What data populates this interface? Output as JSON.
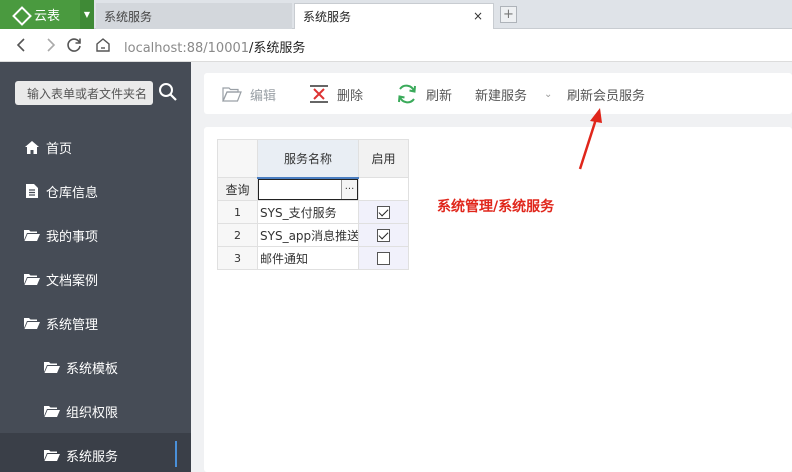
{
  "browser": {
    "brand": "云表",
    "tabs": [
      {
        "label": "系统服务",
        "active": false
      },
      {
        "label": "系统服务",
        "active": true
      }
    ],
    "close_glyph": "×",
    "url": {
      "host": "localhost:88/10001",
      "path": "/系统服务"
    }
  },
  "sidebar": {
    "search_placeholder": "输入表单或者文件夹名",
    "items": [
      {
        "label": "首页",
        "icon": "home-icon",
        "level": 0
      },
      {
        "label": "仓库信息",
        "icon": "document-icon",
        "level": 0
      },
      {
        "label": "我的事项",
        "icon": "folder-open-icon",
        "level": 0
      },
      {
        "label": "文档案例",
        "icon": "folder-open-icon",
        "level": 0
      },
      {
        "label": "系统管理",
        "icon": "folder-open-icon",
        "level": 0
      },
      {
        "label": "系统模板",
        "icon": "folder-open-icon",
        "level": 1
      },
      {
        "label": "组织权限",
        "icon": "folder-open-icon",
        "level": 1
      },
      {
        "label": "系统服务",
        "icon": "folder-open-icon",
        "level": 1,
        "active": true
      }
    ]
  },
  "toolbar": {
    "edit_label": "编辑",
    "delete_label": "删除",
    "refresh_label": "刷新",
    "new_service_label": "新建服务",
    "refresh_member_label": "刷新会员服务"
  },
  "grid": {
    "columns": {
      "name": "服务名称",
      "enable": "启用"
    },
    "filter_label": "查询",
    "filter_button": "...",
    "rows": [
      {
        "num": "1",
        "name": "SYS_支付服务",
        "enabled": true
      },
      {
        "num": "2",
        "name": "SYS_app消息推送服",
        "enabled": true
      },
      {
        "num": "3",
        "name": "邮件通知",
        "enabled": false
      }
    ]
  },
  "annotation": "系统管理/系统服务",
  "colors": {
    "brand": "#4a9a3f",
    "sidebar": "#464c56",
    "annotation": "#e0261b",
    "refresh_icon": "#3aaa5a",
    "delete_icon": "#d33"
  }
}
